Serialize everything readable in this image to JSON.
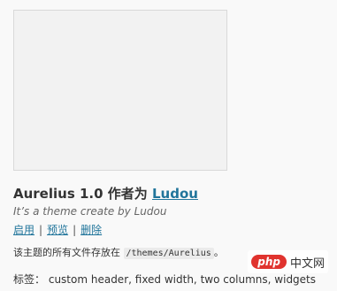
{
  "theme": {
    "name_version": "Aurelius 1.0 作者为 ",
    "author": "Ludou",
    "description": "It’s a theme create by Ludou",
    "actions": [
      "启用",
      "预览",
      "删除"
    ],
    "separator": "|",
    "files_prefix": "该主题的所有文件存放在 ",
    "files_path": "/themes/Aurelius",
    "files_suffix": "。",
    "tags_label": "标签：",
    "tags": "custom header, fixed width, two columns, widgets"
  },
  "watermark": {
    "logo": "php",
    "text": "中文网"
  }
}
